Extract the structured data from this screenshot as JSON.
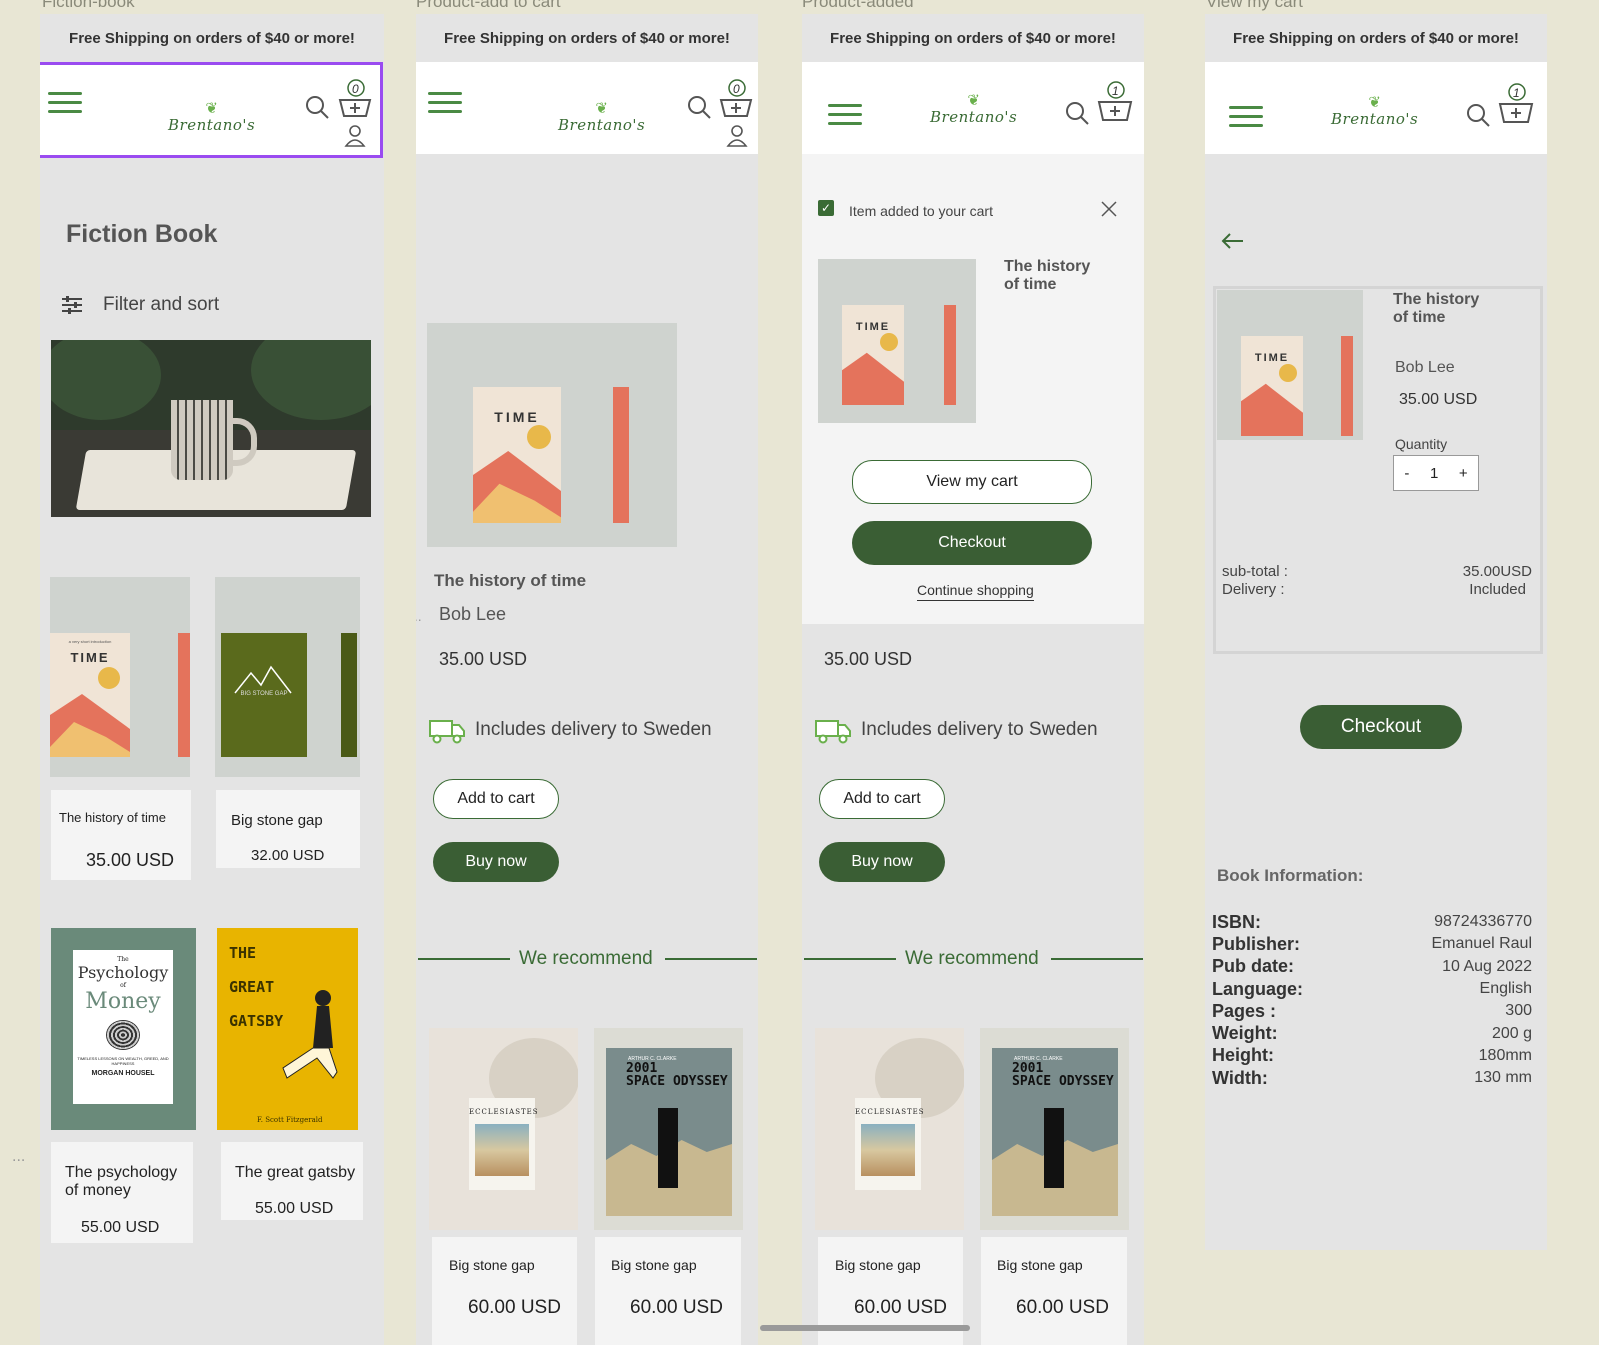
{
  "frames": {
    "f1": {
      "title": "Fiction-book"
    },
    "f2": {
      "title": "Product-add to cart"
    },
    "f3": {
      "title": "Product-added"
    },
    "f4": {
      "title": "View my cart"
    }
  },
  "common": {
    "shipping_banner": "Free Shipping on orders of $40 or more!",
    "brand": "Brentano's",
    "cart_count_empty": "0",
    "cart_count_one": "1",
    "colors": {
      "brand_green": "#3a5e34",
      "accent_green": "#6ab04c",
      "selection": "#9a4bf0"
    }
  },
  "fiction": {
    "heading": "Fiction Book",
    "filter_label": "Filter and sort",
    "products": [
      {
        "title": "The history of time",
        "price": "35.00 USD"
      },
      {
        "title": "Big stone gap",
        "price": "32.00 USD"
      },
      {
        "title": "The psychology of money",
        "price": "55.00 USD"
      },
      {
        "title": "The great gatsby",
        "price": "55.00 USD"
      }
    ]
  },
  "product": {
    "title": "The history of time",
    "author": "Bob Lee",
    "price": "35.00 USD",
    "delivery": "Includes delivery to Sweden",
    "add_to_cart": "Add to cart",
    "buy_now": "Buy now",
    "recommend_heading": "We recommend",
    "recommendations": [
      {
        "title": "Big stone gap",
        "price": "60.00 USD"
      },
      {
        "title": "Big stone gap",
        "price": "60.00 USD"
      }
    ],
    "ellipsis": "..."
  },
  "added_popup": {
    "message": "Item added to your cart",
    "item_title": "The history of time",
    "view_cart": "View my cart",
    "checkout": "Checkout",
    "continue": "Continue shopping"
  },
  "cart": {
    "item_title": "The history of time",
    "author": "Bob Lee",
    "price": "35.00 USD",
    "quantity_label": "Quantity",
    "quantity_value": "1",
    "minus": "-",
    "plus": "+",
    "subtotal_label": "sub-total :",
    "subtotal_value": "35.00USD",
    "delivery_label": "Delivery :",
    "delivery_value": "Included",
    "checkout": "Checkout",
    "book_info_heading": "Book Information:",
    "book_info": [
      {
        "label": "ISBN:",
        "value": "98724336770"
      },
      {
        "label": "Publisher:",
        "value": "Emanuel Raul"
      },
      {
        "label": "Pub date:",
        "value": "10 Aug 2022"
      },
      {
        "label": "Language:",
        "value": "English"
      },
      {
        "label": "Pages :",
        "value": "300"
      },
      {
        "label": "Weight:",
        "value": "200 g"
      },
      {
        "label": "Height:",
        "value": "180mm"
      },
      {
        "label": "Width:",
        "value": "130 mm"
      }
    ]
  },
  "book_covers": {
    "time_series": "a very short introduction",
    "time_word": "THE HISTORY OF",
    "time_main": "TIME",
    "bigstone": "BIG STONE GAP",
    "psych_the": "The",
    "psych_line1": "Psychology",
    "psych_of": "of",
    "psych_line2": "Money",
    "psych_sub": "TIMELESS LESSONS ON WEALTH, GREED, AND HAPPINESS",
    "psych_author": "MORGAN HOUSEL",
    "gatsby_line1": "THE",
    "gatsby_line2": "GREAT",
    "gatsby_line3": "GATSBY",
    "gatsby_author": "F. Scott Fitzgerald",
    "eccl": "ECCLESIASTES",
    "odyssey_author": "ARTHUR C. CLARKE",
    "odyssey_line1": "2001",
    "odyssey_line2": "SPACE ODYSSEY"
  },
  "misc": {
    "side_ellipsis": "..."
  }
}
